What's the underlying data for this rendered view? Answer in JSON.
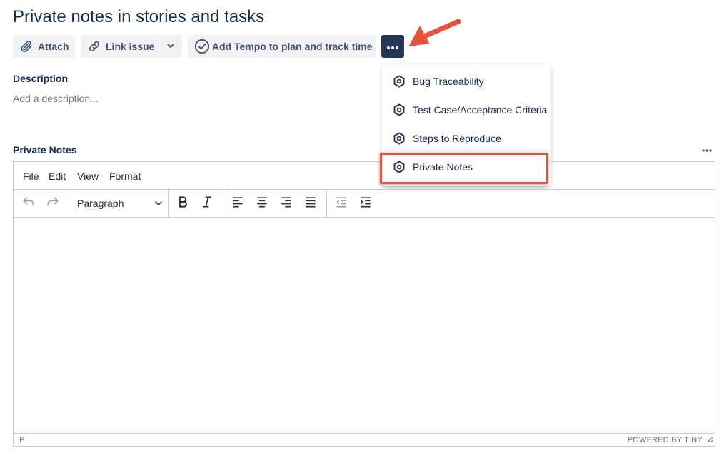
{
  "page": {
    "title": "Private notes in stories and tasks"
  },
  "toolbar": {
    "attach_label": "Attach",
    "link_issue_label": "Link issue",
    "tempo_label": "Add Tempo to plan and track time",
    "more_icon": "ellipsis-icon"
  },
  "description": {
    "label": "Description",
    "placeholder": "Add a description..."
  },
  "private_notes": {
    "label": "Private Notes",
    "editor": {
      "menu": [
        "File",
        "Edit",
        "View",
        "Format"
      ],
      "block_format": "Paragraph",
      "status_path": "P",
      "branding": "POWERED BY TINY"
    }
  },
  "dropdown": {
    "items": [
      {
        "label": "Bug Traceability",
        "icon": "hexagon-app-icon"
      },
      {
        "label": "Test Case/Acceptance Criteria",
        "icon": "hexagon-app-icon"
      },
      {
        "label": "Steps to Reproduce",
        "icon": "hexagon-app-icon"
      },
      {
        "label": "Private Notes",
        "icon": "hexagon-app-icon",
        "highlighted": true
      }
    ]
  },
  "colors": {
    "text": "#172b4d",
    "button_bg": "#f1f2f4",
    "more_button_bg": "#253858",
    "annotation": "#e5533d"
  }
}
